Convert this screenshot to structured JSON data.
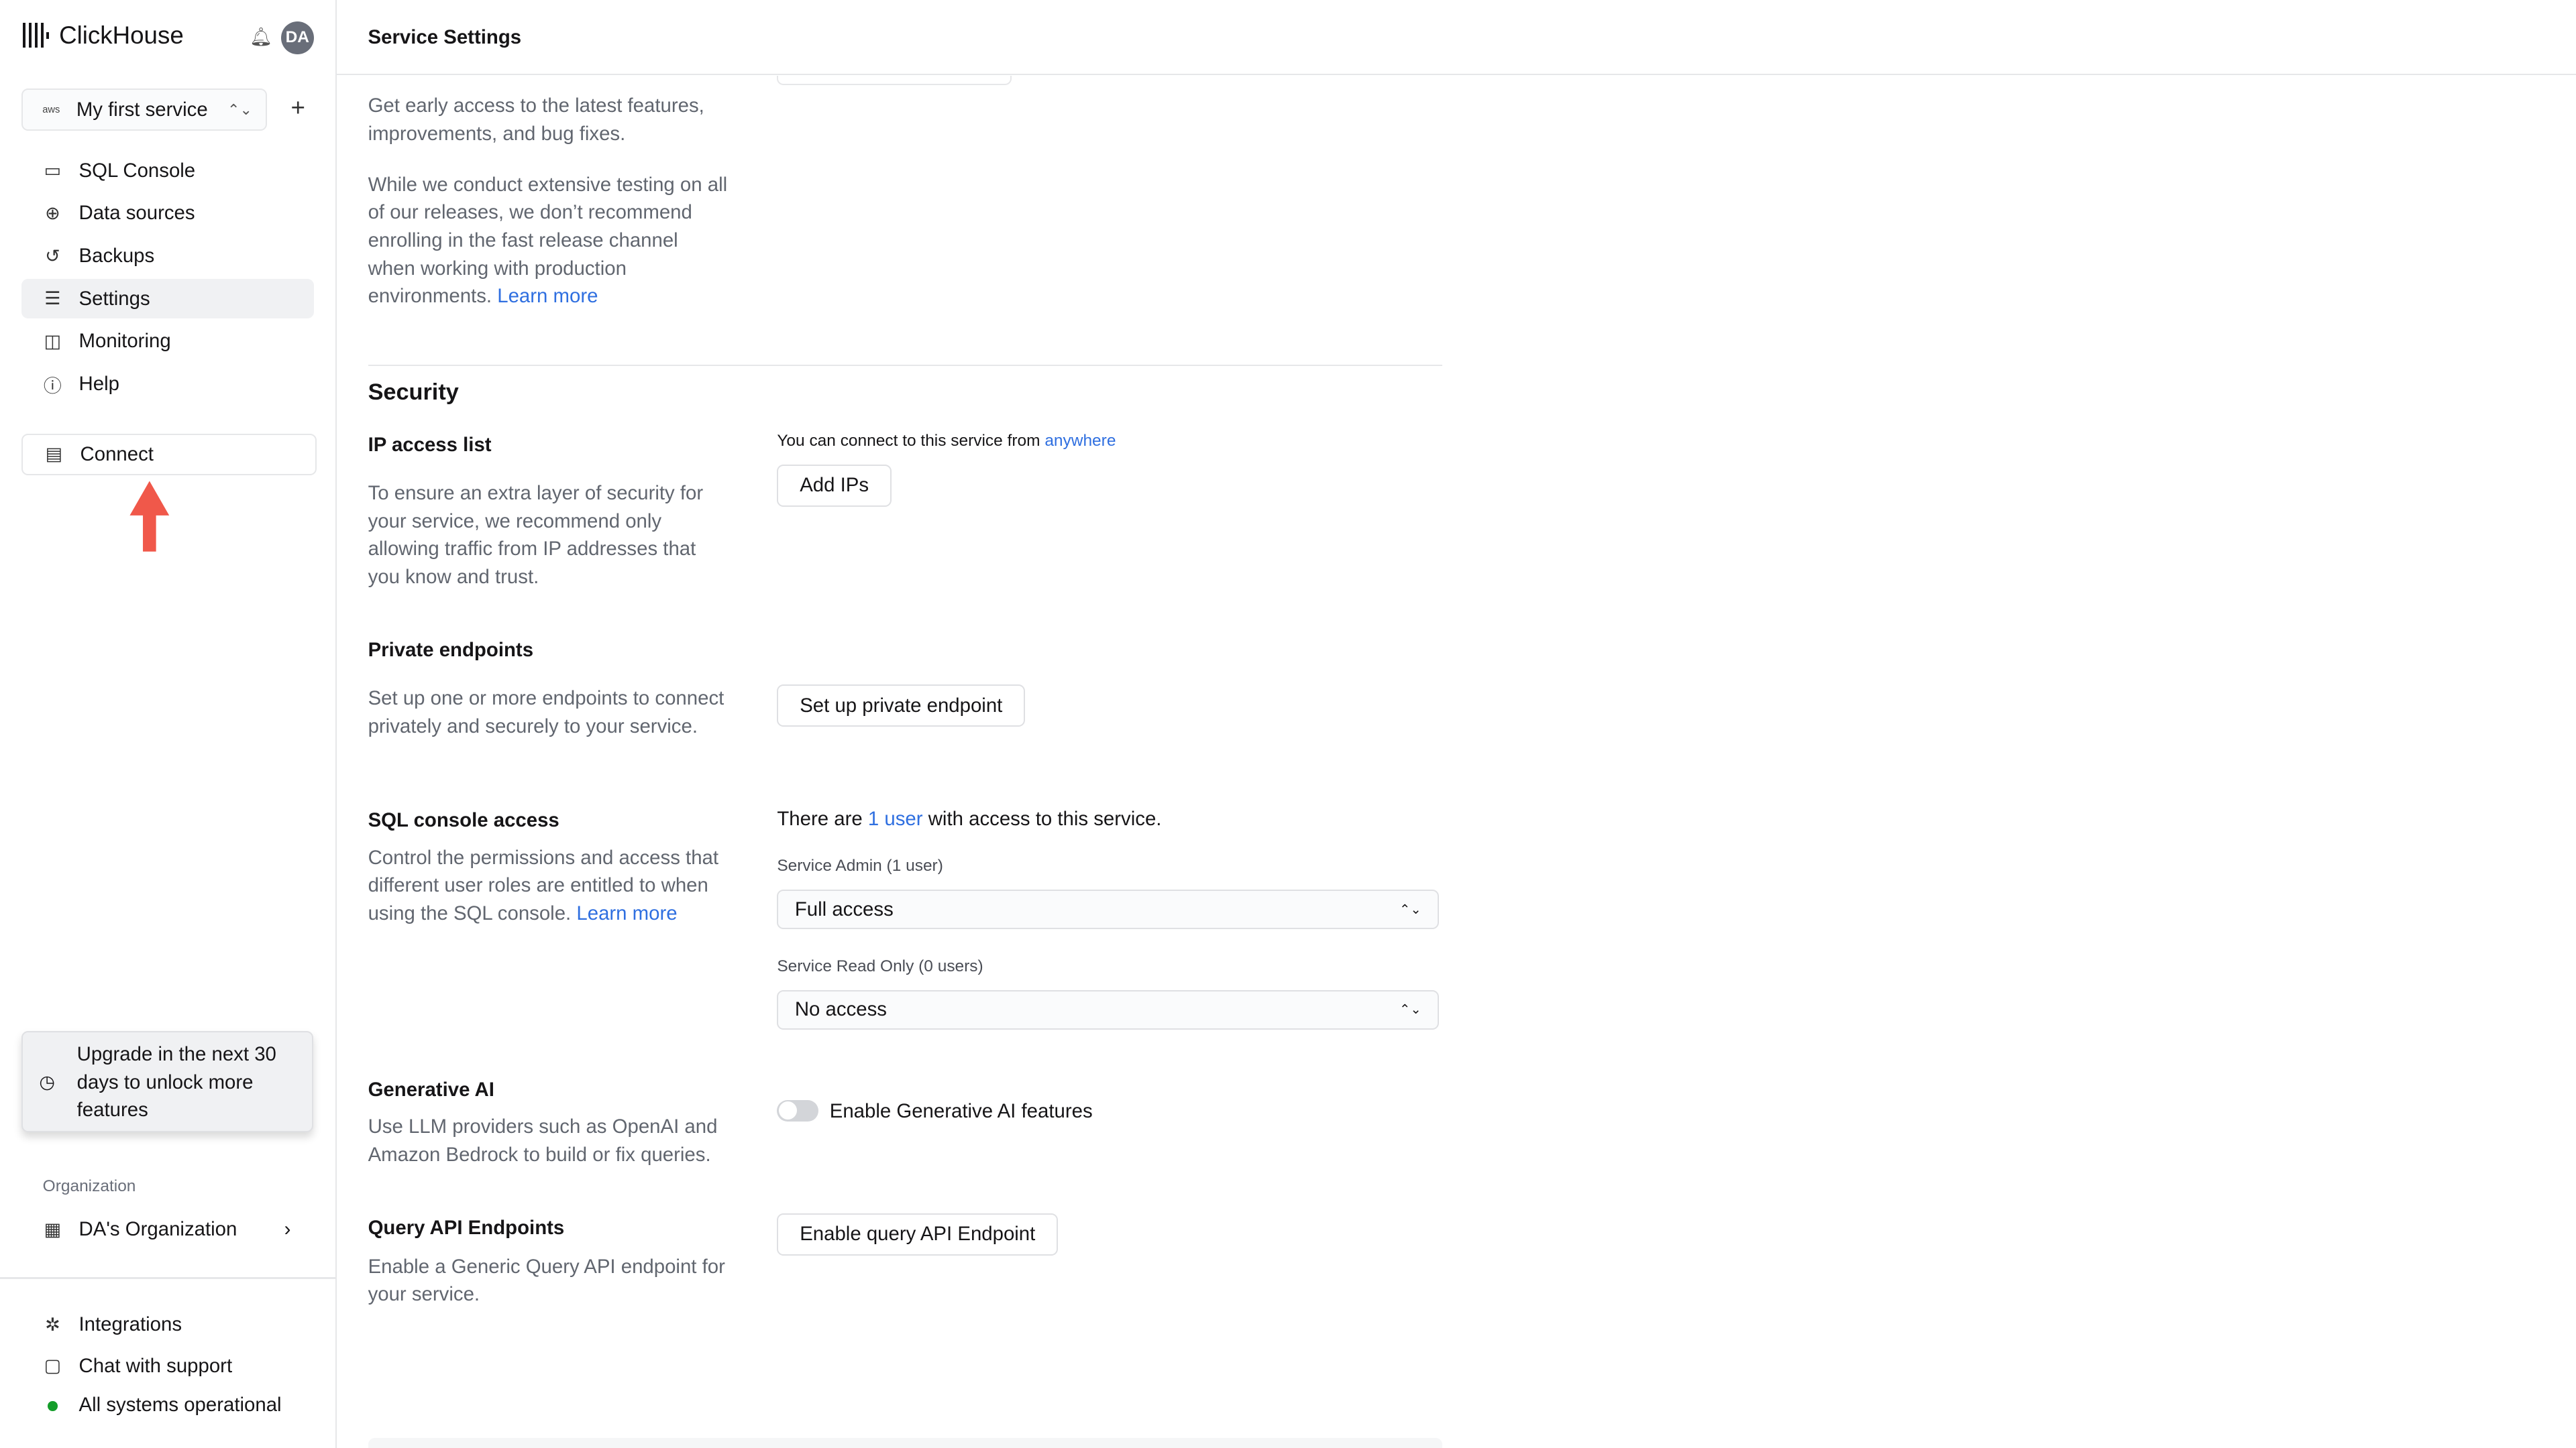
{
  "app": {
    "brand": "ClickHouse",
    "avatar_initials": "DA",
    "service_name": "My first service",
    "service_provider": "aws"
  },
  "sidebar": {
    "items": [
      {
        "label": "SQL Console",
        "icon": "sql-console-icon"
      },
      {
        "label": "Data sources",
        "icon": "data-sources-icon"
      },
      {
        "label": "Backups",
        "icon": "backups-icon"
      },
      {
        "label": "Settings",
        "icon": "settings-icon",
        "active": true
      },
      {
        "label": "Monitoring",
        "icon": "monitoring-icon"
      },
      {
        "label": "Help",
        "icon": "help-icon"
      }
    ],
    "connect": "Connect",
    "upgrade": "Upgrade in the next 30 days to unlock more features",
    "org_label": "Organization",
    "org_name": "DA's Organization",
    "footer": {
      "integrations": "Integrations",
      "chat": "Chat with support",
      "status": "All systems operational",
      "status_color": "#149d2a"
    }
  },
  "header": {
    "title": "Service Settings"
  },
  "release": {
    "p1": "Get early access to the latest features, improvements, and bug fixes.",
    "p2": "While we conduct extensive testing on all of our releases, we don’t recommend enrolling in the fast release channel when working with production environments.",
    "learn_more": "Learn more"
  },
  "security": {
    "title": "Security",
    "ip": {
      "title": "IP access list",
      "desc": "To ensure an extra layer of security for your service, we recommend only allowing traffic from IP addresses that you know and trust.",
      "status_prefix": "You can connect to this service from",
      "status_link": "anywhere",
      "button": "Add IPs"
    },
    "private": {
      "title": "Private endpoints",
      "desc": "Set up one or more endpoints to connect privately and securely to your service.",
      "button": "Set up private endpoint"
    },
    "sql": {
      "title": "SQL console access",
      "desc": "Control the permissions and access that different user roles are entitled to when using the SQL console.",
      "learn_more": "Learn more",
      "status_prefix": "There are",
      "status_link": "1 user",
      "status_suffix": "with access to this service.",
      "admin_label": "Service Admin (1 user)",
      "admin_value": "Full access",
      "readonly_label": "Service Read Only (0 users)",
      "readonly_value": "No access"
    },
    "genai": {
      "title": "Generative AI",
      "desc": "Use LLM providers such as OpenAI and Amazon Bedrock to build or fix queries.",
      "toggle_label": "Enable Generative AI features",
      "enabled": false
    },
    "query_api": {
      "title": "Query API Endpoints",
      "desc": "Enable a Generic Query API endpoint for your service.",
      "button": "Enable query API Endpoint"
    }
  },
  "colors": {
    "accent": "#2f6fe0",
    "annotation_arrow": "#f0584a"
  }
}
